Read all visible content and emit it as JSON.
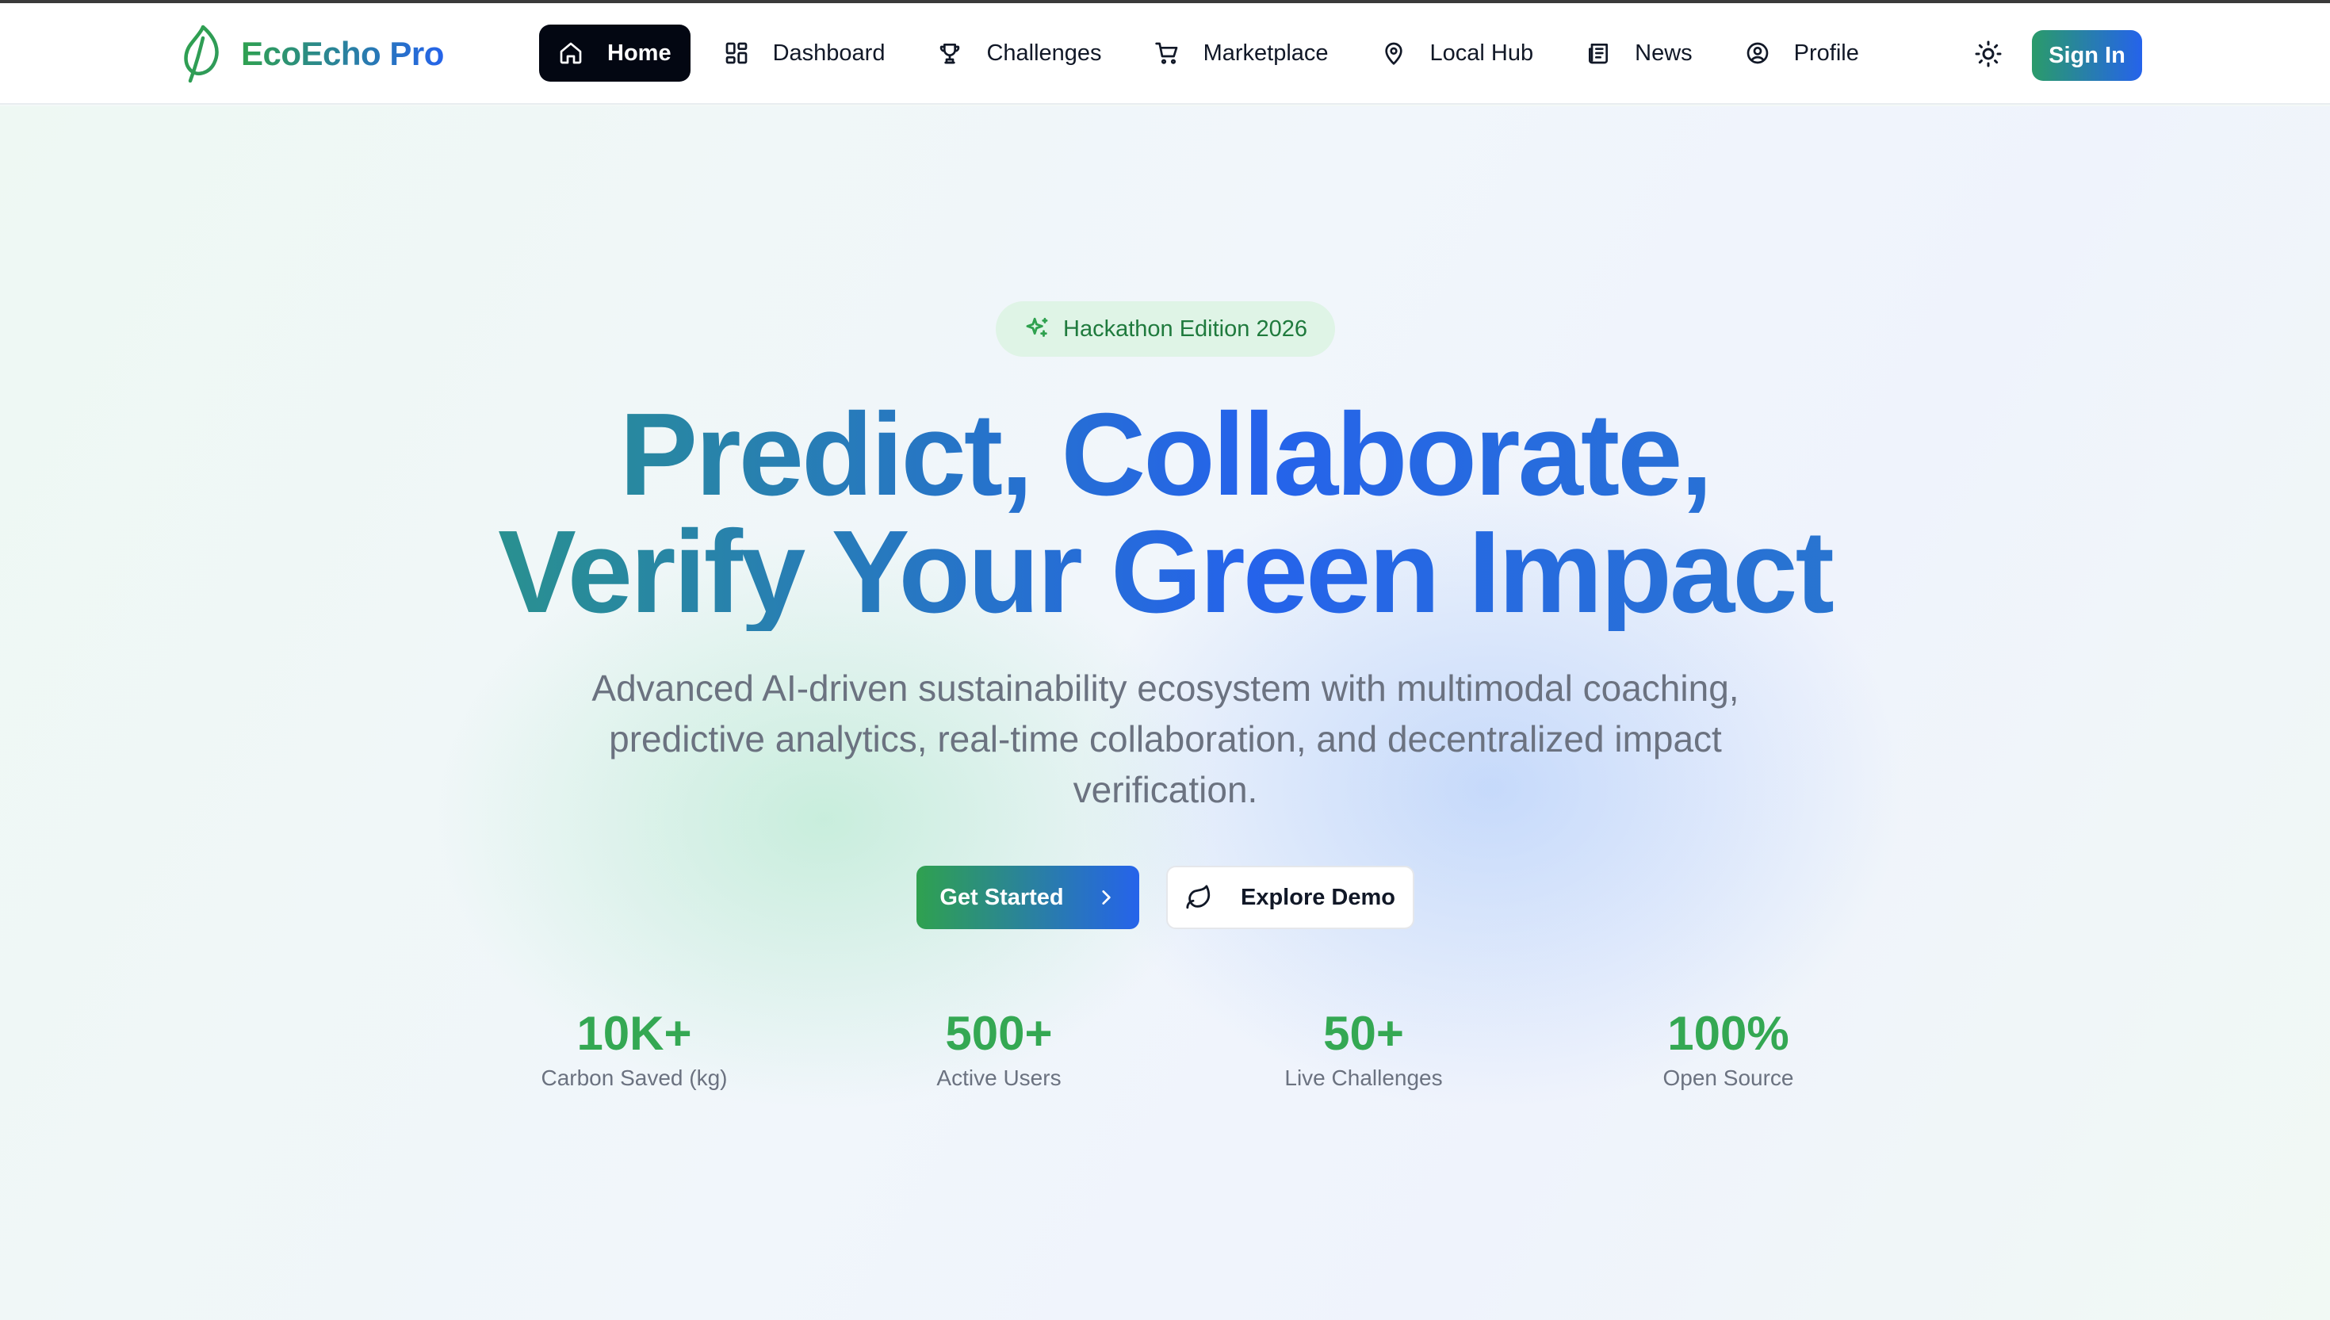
{
  "brand": {
    "name": "EcoEcho Pro",
    "logo_icon": "leaf-icon"
  },
  "nav": {
    "items": [
      {
        "label": "Home",
        "icon": "home-icon",
        "active": true
      },
      {
        "label": "Dashboard",
        "icon": "grid-icon",
        "active": false
      },
      {
        "label": "Challenges",
        "icon": "trophy-icon",
        "active": false
      },
      {
        "label": "Marketplace",
        "icon": "cart-icon",
        "active": false
      },
      {
        "label": "Local Hub",
        "icon": "map-pin-icon",
        "active": false
      },
      {
        "label": "News",
        "icon": "newspaper-icon",
        "active": false
      },
      {
        "label": "Profile",
        "icon": "user-circle-icon",
        "active": false
      }
    ]
  },
  "header": {
    "theme_icon": "sun-icon",
    "signin_label": "Sign In"
  },
  "hero": {
    "badge": "Hackathon Edition 2026",
    "headline_line1": "Predict, Collaborate,",
    "headline_line2": "Verify Your Green Impact",
    "subtitle": "Advanced AI-driven sustainability ecosystem with multimodal coaching, predictive analytics, real-time collaboration, and decentralized impact verification.",
    "primary_cta": "Get Started",
    "secondary_cta": "Explore Demo"
  },
  "stats": [
    {
      "value": "10K+",
      "label": "Carbon Saved (kg)"
    },
    {
      "value": "500+",
      "label": "Active Users"
    },
    {
      "value": "50+",
      "label": "Live Challenges"
    },
    {
      "value": "100%",
      "label": "Open Source"
    }
  ],
  "colors": {
    "brand_green": "#2fa14f",
    "brand_blue": "#2563eb",
    "stat_green": "#34a853",
    "active_nav_bg": "#030712"
  }
}
